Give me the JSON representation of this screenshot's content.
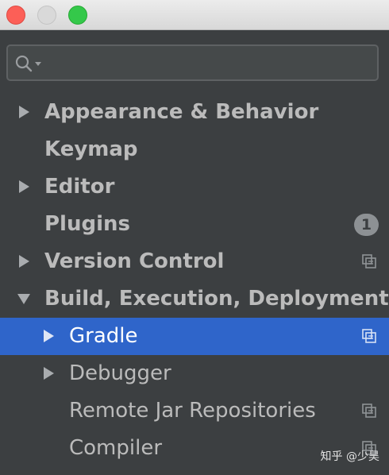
{
  "search": {
    "placeholder": "",
    "value": ""
  },
  "tree": {
    "items": [
      {
        "label": "Appearance & Behavior",
        "level": 0,
        "arrow": "right"
      },
      {
        "label": "Keymap",
        "level": 0,
        "arrow": "none"
      },
      {
        "label": "Editor",
        "level": 0,
        "arrow": "right"
      },
      {
        "label": "Plugins",
        "level": 0,
        "arrow": "none",
        "badge": "1"
      },
      {
        "label": "Version Control",
        "level": 0,
        "arrow": "right",
        "icon": "project-settings-icon"
      },
      {
        "label": "Build, Execution, Deployment",
        "level": 0,
        "arrow": "down"
      },
      {
        "label": "Gradle",
        "level": 1,
        "arrow": "right",
        "icon": "project-settings-icon",
        "selected": true
      },
      {
        "label": "Debugger",
        "level": 1,
        "arrow": "right"
      },
      {
        "label": "Remote Jar Repositories",
        "level": 1,
        "arrow": "none",
        "icon": "project-settings-icon"
      },
      {
        "label": "Compiler",
        "level": 1,
        "arrow": "none",
        "icon": "project-settings-icon"
      }
    ]
  },
  "watermark": "知乎 @少昊",
  "colors": {
    "background": "#3c3f41",
    "selection": "#2f65ca",
    "text": "#bbbbbb"
  }
}
